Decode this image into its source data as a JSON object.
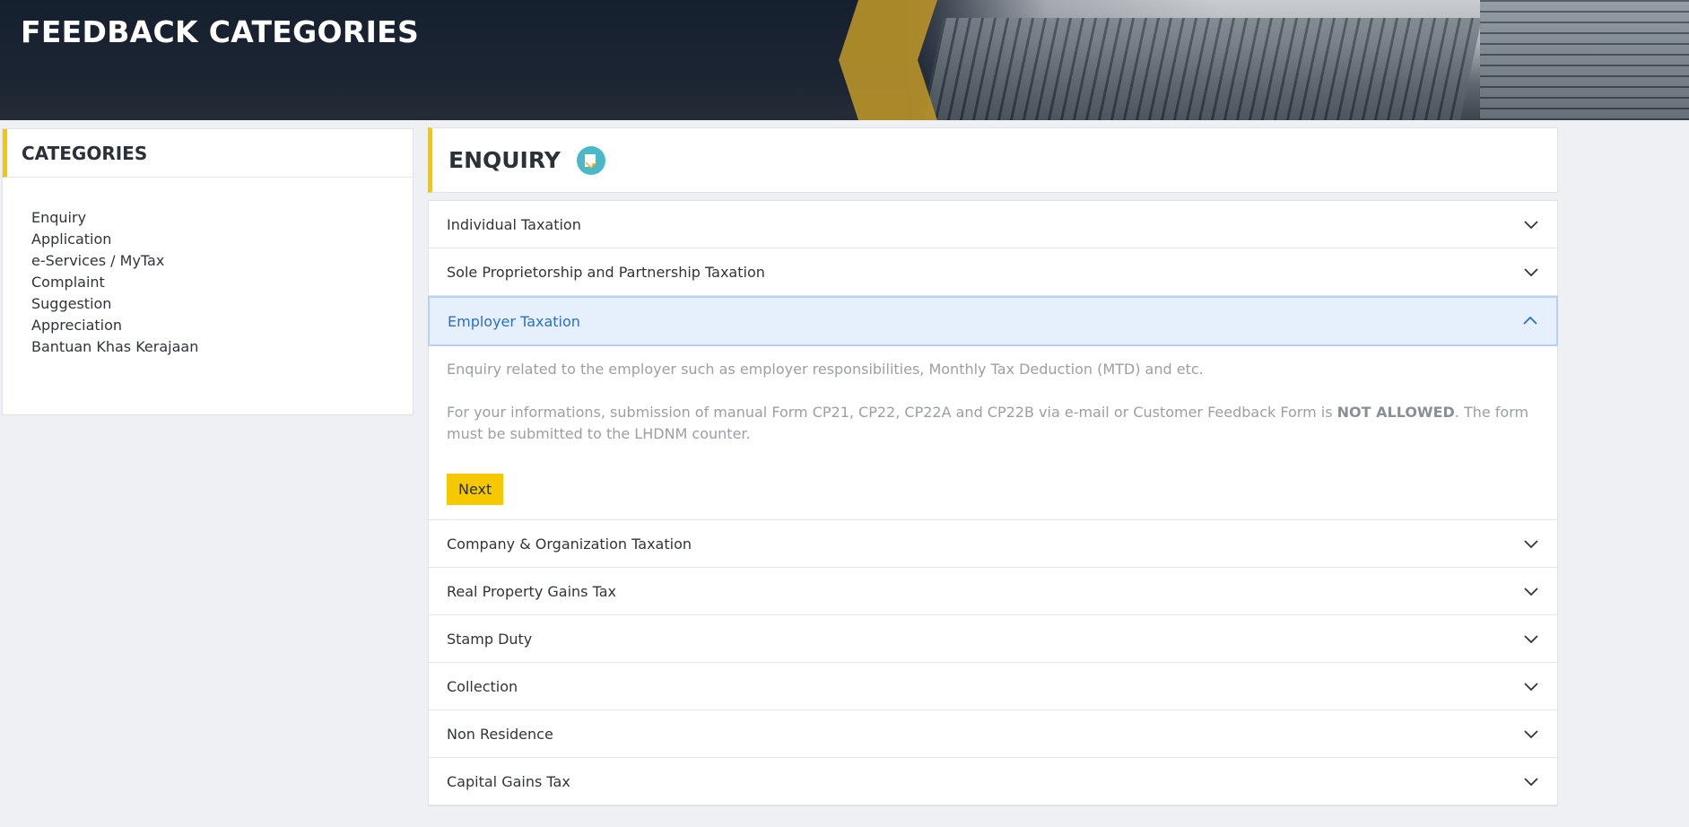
{
  "header": {
    "title": "FEEDBACK CATEGORIES"
  },
  "sidebar": {
    "title": "CATEGORIES",
    "items": [
      {
        "label": "Enquiry"
      },
      {
        "label": "Application"
      },
      {
        "label": "e-Services / MyTax"
      },
      {
        "label": "Complaint"
      },
      {
        "label": "Suggestion"
      },
      {
        "label": "Appreciation"
      },
      {
        "label": "Bantuan Khas Kerajaan"
      }
    ]
  },
  "main": {
    "title": "ENQUIRY",
    "icon": "enquiry-icon",
    "accordion": {
      "items": [
        {
          "label": "Individual Taxation"
        },
        {
          "label": "Sole Proprietorship and Partnership Taxation"
        },
        {
          "label": "Employer Taxation",
          "expanded": true,
          "description": "Enquiry related to the employer such as employer responsibilities, Monthly Tax Deduction (MTD) and etc.",
          "note_before": "For your informations, submission of manual Form CP21, CP22, CP22A and CP22B via e-mail or Customer Feedback Form is ",
          "note_bold": "NOT ALLOWED",
          "note_after": ". The form must be submitted to the LHDNM counter.",
          "button_label": "Next"
        },
        {
          "label": "Company & Organization Taxation"
        },
        {
          "label": "Real Property Gains Tax"
        },
        {
          "label": "Stamp Duty"
        },
        {
          "label": "Collection"
        },
        {
          "label": "Non Residence"
        },
        {
          "label": "Capital Gains Tax"
        }
      ]
    }
  },
  "colors": {
    "accent": "#f5c800",
    "active_bg": "#e6f0fd",
    "active_text": "#2b6fc2",
    "banner_bg": "#1c2533",
    "page_bg": "#eef0f3"
  }
}
